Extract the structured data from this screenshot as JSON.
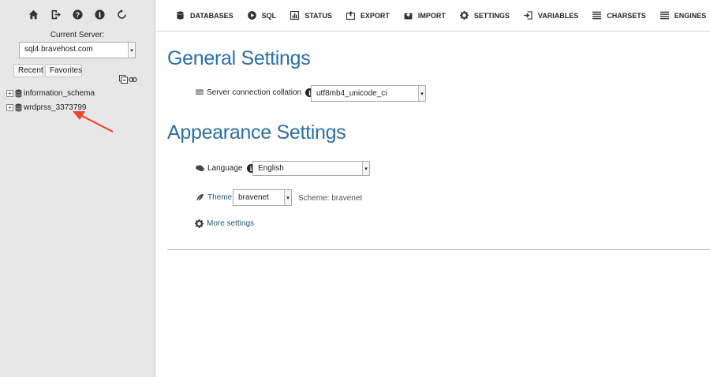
{
  "nav": {
    "icons": [
      "home-icon",
      "logout-icon",
      "help-icon",
      "info-icon",
      "reload-icon"
    ],
    "server_label": "Current Server:",
    "server_value": "sql4.bravehost.com",
    "recent_label": "Recent",
    "favorites_label": "Favorites",
    "databases": [
      {
        "name": "information_schema"
      },
      {
        "name": "wrdprss_3373799"
      }
    ]
  },
  "menubar": {
    "tabs": [
      {
        "label": "DATABASES",
        "icon": "database-icon"
      },
      {
        "label": "SQL",
        "icon": "play-icon"
      },
      {
        "label": "STATUS",
        "icon": "status-icon"
      },
      {
        "label": "EXPORT",
        "icon": "export-icon"
      },
      {
        "label": "IMPORT",
        "icon": "import-icon"
      },
      {
        "label": "SETTINGS",
        "icon": "gear-icon"
      },
      {
        "label": "VARIABLES",
        "icon": "variables-icon"
      },
      {
        "label": "CHARSETS",
        "icon": "charsets-icon"
      },
      {
        "label": "ENGINES",
        "icon": "engines-icon"
      }
    ]
  },
  "general": {
    "title": "General Settings",
    "collation_label": "Server connection collation",
    "collation_value": "utf8mb4_unicode_ci"
  },
  "appearance": {
    "title": "Appearance Settings",
    "language_label": "Language",
    "language_value": "English",
    "theme_label": "Theme:",
    "theme_value": "bravenet",
    "scheme_text": "Scheme: bravenet",
    "more_settings": "More settings"
  },
  "colors": {
    "heading": "#2a6fa8",
    "nav_bg": "#e7e7e7",
    "arrow": "#f0452c"
  }
}
